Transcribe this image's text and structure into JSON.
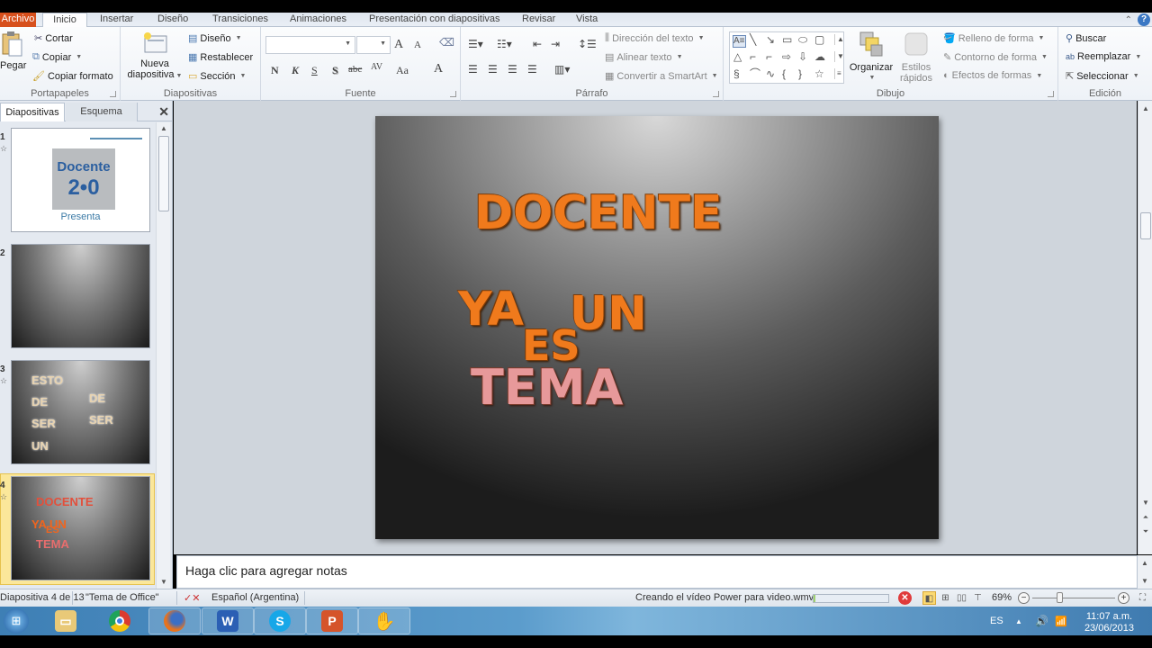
{
  "ribbon_tabs": [
    "Archivo",
    "Inicio",
    "Insertar",
    "Diseño",
    "Transiciones",
    "Animaciones",
    "Presentación con diapositivas",
    "Revisar",
    "Vista"
  ],
  "active_tab": "Inicio",
  "portapapeles": {
    "label": "Portapapeles",
    "paste": "Pegar",
    "cut": "Cortar",
    "copy": "Copiar",
    "format_painter": "Copiar formato"
  },
  "diapositivas": {
    "label": "Diapositivas",
    "new_slide_1": "Nueva",
    "new_slide_2": "diapositiva",
    "layout": "Diseño",
    "reset": "Restablecer",
    "section": "Sección"
  },
  "fuente": {
    "label": "Fuente",
    "font_name": "",
    "font_size": "",
    "bold": "N",
    "italic": "K",
    "underline": "S",
    "shadow": "S",
    "strike": "abc",
    "spacing": "AV",
    "case": "Aa",
    "grow": "A",
    "shrink": "A",
    "color": "A"
  },
  "parrafo": {
    "label": "Párrafo",
    "text_direction": "Dirección del texto",
    "align_text": "Alinear texto",
    "smartart": "Convertir a SmartArt"
  },
  "dibujo": {
    "label": "Dibujo",
    "arrange": "Organizar",
    "quick_styles_1": "Estilos",
    "quick_styles_2": "rápidos",
    "fill": "Relleno de forma",
    "outline": "Contorno de forma",
    "effects": "Efectos de formas"
  },
  "edicion": {
    "label": "Edición",
    "find": "Buscar",
    "replace": "Reemplazar",
    "select": "Seleccionar"
  },
  "panel": {
    "tab_slides": "Diapositivas",
    "tab_outline": "Esquema",
    "thumbnails": [
      {
        "num": "1",
        "logo_line1": "Docente",
        "logo_line2": "2•0",
        "caption": "Presenta"
      },
      {
        "num": "2"
      },
      {
        "num": "3",
        "words": [
          "ESTO",
          "DE",
          "SER",
          "UN",
          "DE",
          "SER"
        ]
      },
      {
        "num": "4",
        "words": [
          "DOCENTE",
          "YA UN",
          "ES",
          "TEMA"
        ]
      }
    ]
  },
  "slide": {
    "line1": "DOCENTE",
    "ya": "YA",
    "un": "UN",
    "es": "ES",
    "tema": "TEMA"
  },
  "notes_placeholder": "Haga clic para agregar notas",
  "status": {
    "slide_info": "Diapositiva 4 de 13",
    "theme": "\"Tema de Office\"",
    "language": "Español (Argentina)",
    "video_task": "Creando el vídeo Power para video.wmv",
    "video_progress_percent": 3,
    "zoom": "69%",
    "zoom_level_percent": 69
  },
  "taskbar": {
    "apps": [
      "Explorador de Windows",
      "Google Chrome",
      "Firefox",
      "Word",
      "Skype",
      "PowerPoint",
      "VLC"
    ],
    "lang": "ES",
    "time": "11:07 a.m.",
    "date": "23/06/2013"
  }
}
